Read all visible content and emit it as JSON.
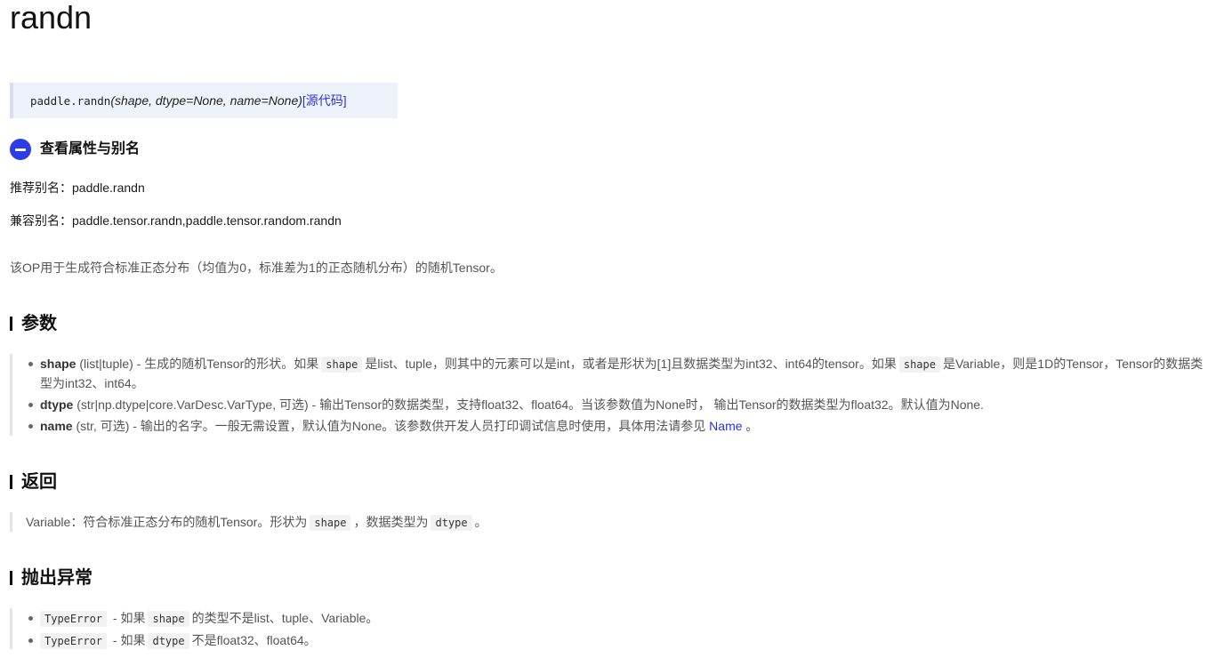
{
  "page": {
    "title": "randn",
    "signature": {
      "prefix": "paddle.randn",
      "params": "(shape, dtype=None, name=None)",
      "source_link": "[源代码]"
    },
    "aliases": {
      "toggle_label": "查看属性与别名",
      "recommended": "推荐别名：paddle.randn",
      "compatible": "兼容别名：paddle.tensor.randn,paddle.tensor.random.randn"
    },
    "description": "该OP用于生成符合标准正态分布（均值为0，标准差为1的正态随机分布）的随机Tensor。",
    "params_section": {
      "heading": "参数",
      "items": [
        {
          "name": "shape",
          "type": "(list|tuple)",
          "text1": " - 生成的随机Tensor的形状。如果",
          "code1": "shape",
          "text2": "是list、tuple，则其中的元素可以是int，或者是形状为[1]且数据类型为int32、int64的tensor。如果",
          "code2": "shape",
          "text3": "是Variable，则是1D的Tensor，Tensor的数据类型为int32、int64。"
        },
        {
          "name": "dtype",
          "type": "(str|np.dtype|core.VarDesc.VarType, 可选)",
          "text1": " - 输出Tensor的数据类型，支持float32、float64。当该参数值为None时， 输出Tensor的数据类型为float32。默认值为None."
        },
        {
          "name": "name",
          "type": "(str, 可选)",
          "text1": " - 输出的名字。一般无需设置，默认值为None。该参数供开发人员打印调试信息时使用，具体用法请参见 ",
          "link": "Name",
          "text2": " 。"
        }
      ]
    },
    "returns_section": {
      "heading": "返回",
      "text1": "Variable：符合标准正态分布的随机Tensor。形状为",
      "code1": "shape",
      "text2": "，数据类型为",
      "code2": "dtype",
      "text3": "。"
    },
    "raises_section": {
      "heading": "抛出异常",
      "items": [
        {
          "code1": "TypeError",
          "text1": " - 如果",
          "code2": "shape",
          "text2": "的类型不是list、tuple、Variable。"
        },
        {
          "code1": "TypeError",
          "text1": " - 如果",
          "code2": "dtype",
          "text2": "不是float32、float64。"
        }
      ]
    }
  }
}
